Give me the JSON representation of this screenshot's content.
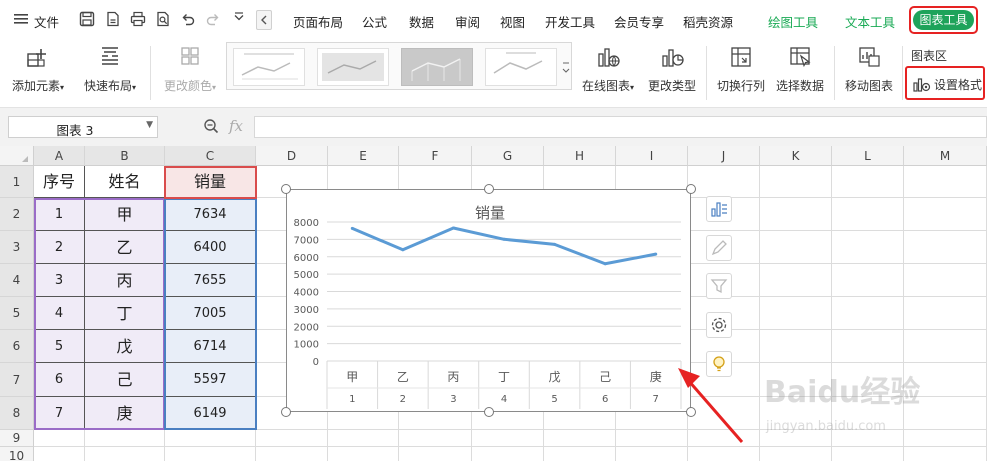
{
  "menubar": {
    "file_label": "文件",
    "tabs": [
      "页面布局",
      "公式",
      "数据",
      "审阅",
      "视图",
      "开发工具",
      "会员专享",
      "稻壳资源"
    ],
    "context_tabs": [
      "绘图工具",
      "文本工具"
    ],
    "active_tab": "图表工具"
  },
  "ribbon": {
    "add_element": "添加元素",
    "quick_layout": "快速布局",
    "change_color": "更改颜色",
    "online_chart": "在线图表",
    "change_type": "更改类型",
    "switch_row_col": "切换行列",
    "select_data": "选择数据",
    "move_chart": "移动图表",
    "chart_area": "图表区",
    "set_format": "设置格式"
  },
  "formula_bar": {
    "name_box": "图表 3",
    "fx_label": "fx",
    "value": ""
  },
  "grid": {
    "columns": [
      "A",
      "B",
      "C",
      "D",
      "E",
      "F",
      "G",
      "H",
      "I",
      "J",
      "K",
      "L",
      "M"
    ],
    "rows": [
      "1",
      "2",
      "3",
      "4",
      "5",
      "6",
      "7",
      "8",
      "9",
      "10"
    ],
    "header": [
      "序号",
      "姓名",
      "销量"
    ],
    "data": [
      [
        "1",
        "甲",
        "7634"
      ],
      [
        "2",
        "乙",
        "6400"
      ],
      [
        "3",
        "丙",
        "7655"
      ],
      [
        "4",
        "丁",
        "7005"
      ],
      [
        "5",
        "戊",
        "6714"
      ],
      [
        "6",
        "己",
        "5597"
      ],
      [
        "7",
        "庚",
        "6149"
      ]
    ]
  },
  "chart_data": {
    "type": "line",
    "title": "销量",
    "categories": [
      "甲",
      "乙",
      "丙",
      "丁",
      "戊",
      "己",
      "庚"
    ],
    "sub_categories": [
      "1",
      "2",
      "3",
      "4",
      "5",
      "6",
      "7"
    ],
    "series": [
      {
        "values": [
          7634,
          6400,
          7655,
          7005,
          6714,
          5597,
          6149
        ]
      }
    ],
    "ylim": [
      0,
      8000
    ],
    "yticks": [
      "8000",
      "7000",
      "6000",
      "5000",
      "4000",
      "3000",
      "2000",
      "1000",
      "0"
    ],
    "grid": true,
    "line_color": "#5b9bd5"
  },
  "colors": {
    "accent_green": "#1ea35a",
    "highlight_red": "#e62222",
    "selection_blue": "#e8eef8",
    "selection_purple": "#f0ebf7"
  },
  "watermark": {
    "brand": "Baidu经验",
    "url": "jingyan.baidu.com"
  }
}
